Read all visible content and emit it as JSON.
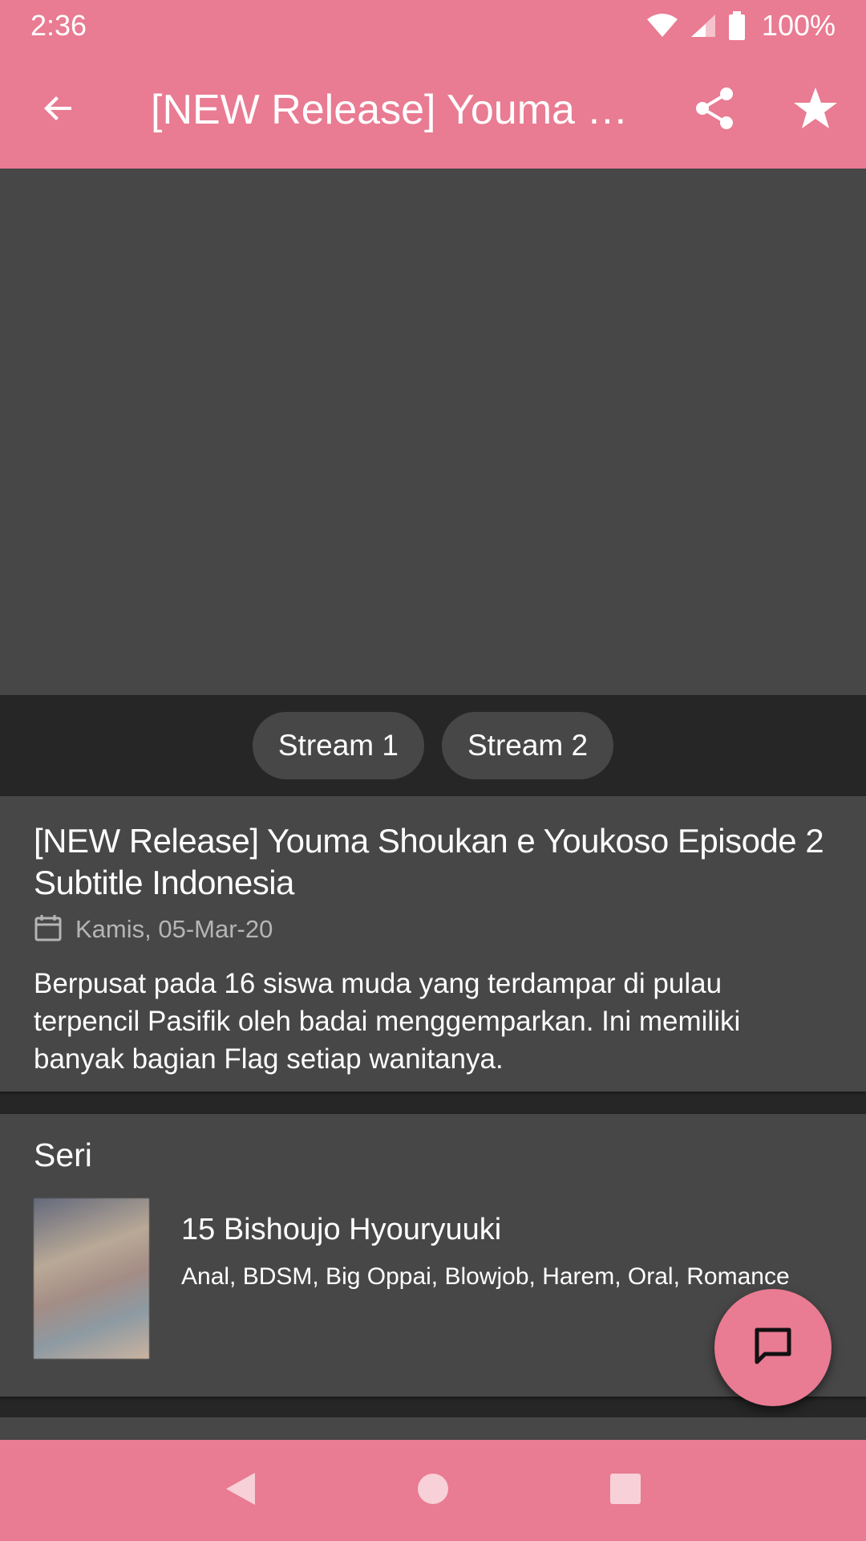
{
  "status_bar": {
    "time": "2:36",
    "battery": "100%",
    "icons": [
      "wifi-icon",
      "signal-icon",
      "battery-icon"
    ]
  },
  "app_bar": {
    "title": "[NEW Release] Youma Shoukan e Youkoso Episode 2 Subtitle Indonesia",
    "back_icon": "arrow-back-icon",
    "share_icon": "share-icon",
    "favorite_icon": "star-icon"
  },
  "streams": {
    "buttons": [
      "Stream 1",
      "Stream 2"
    ]
  },
  "episode": {
    "title": "[NEW Release] Youma Shoukan e Youkoso Episode 2 Subtitle Indonesia",
    "date": "Kamis, 05-Mar-20",
    "description": "Berpusat pada 16 siswa muda yang terdampar di pulau terpencil Pasifik oleh badai menggemparkan. Ini memiliki banyak bagian Flag setiap wanitanya."
  },
  "series": {
    "heading": "Seri",
    "items": [
      {
        "name": "15 Bishoujo Hyouryuuki",
        "tags": "Anal, BDSM, Big Oppai, Blowjob, Harem, Oral, Romance"
      }
    ]
  },
  "fab": {
    "icon": "comment-icon"
  },
  "nav_bar": {
    "icons": [
      "back-triangle-icon",
      "home-circle-icon",
      "recents-square-icon"
    ]
  },
  "colors": {
    "accent": "#e97b92",
    "surface": "#474747",
    "background": "#262626",
    "muted_text": "#b5b5b5"
  }
}
